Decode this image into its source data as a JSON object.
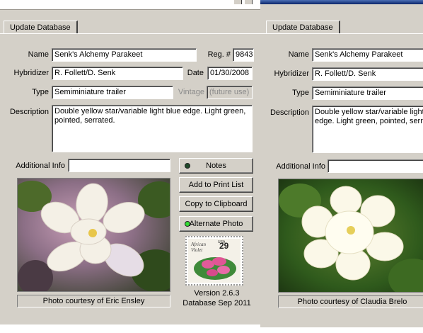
{
  "left_window": {
    "tab_label": "Update Database",
    "labels": {
      "name": "Name",
      "reg": "Reg. #",
      "hybridizer": "Hybridizer",
      "date": "Date",
      "type": "Type",
      "vintage": "Vintage",
      "description": "Description",
      "additional_info": "Additional Info"
    },
    "fields": {
      "name": "Senk's Alchemy Parakeet",
      "reg": "9843",
      "hybridizer": "R. Follett/D. Senk",
      "date": "01/30/2008",
      "type": "Semiminiature trailer",
      "vintage": "(future use)",
      "description": "Double yellow star/variable light blue edge. Light green, pointed, serrated.",
      "additional_info": ""
    },
    "buttons": {
      "notes": "Notes",
      "add_print": "Add to Print List",
      "copy_clip": "Copy to Clipboard",
      "alt_photo": "Alternate Photo"
    },
    "stamp": {
      "text": "African Violet",
      "denomination": "USA 29"
    },
    "version": "Version 2.6.3",
    "database": "Database Sep 2011",
    "photo_caption": "Photo courtesy of Eric Ensley"
  },
  "right_window": {
    "tab_label": "Update Database",
    "labels": {
      "name": "Name",
      "hybridizer": "Hybridizer",
      "type": "Type",
      "description": "Description",
      "additional_info": "Additional Info"
    },
    "fields": {
      "name": "Senk's Alchemy Parakeet",
      "hybridizer": "R. Follett/D. Senk",
      "type": "Semiminiature trailer",
      "description": "Double yellow star/variable light blue edge. Light green, pointed, serrated.",
      "additional_info": ""
    },
    "photo_caption": "Photo courtesy of Claudia Brelo"
  },
  "colors": {
    "window_bg": "#d4d0c8",
    "led_notes": "#1f4a2a",
    "led_alt": "#33dd33",
    "title_blue": "#0a246a"
  }
}
